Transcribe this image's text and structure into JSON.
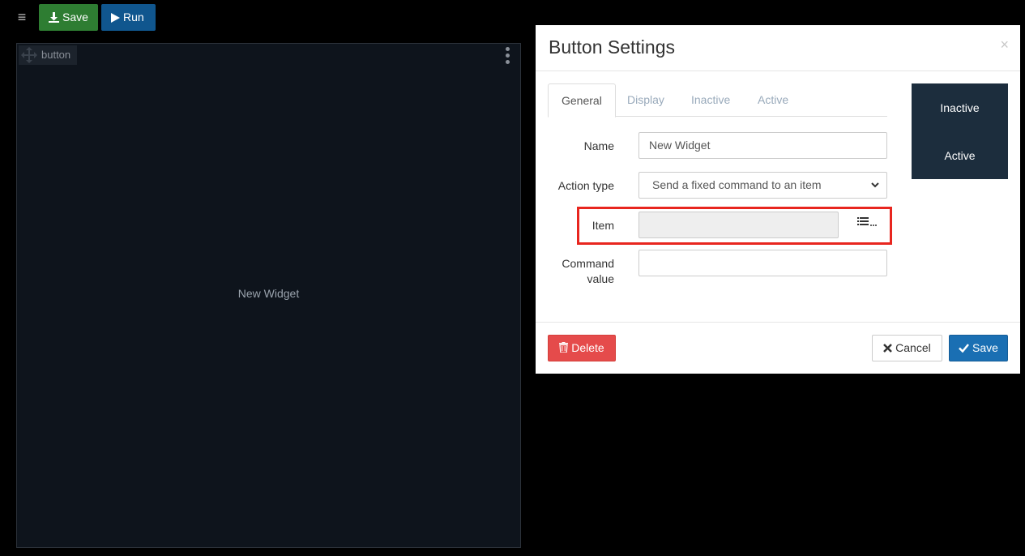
{
  "toolbar": {
    "save_label": "Save",
    "run_label": "Run"
  },
  "canvas": {
    "widget_tag": "button",
    "widget_label": "New Widget"
  },
  "modal": {
    "title": "Button Settings",
    "close": "×",
    "tabs": [
      {
        "label": "General"
      },
      {
        "label": "Display"
      },
      {
        "label": "Inactive"
      },
      {
        "label": "Active"
      }
    ],
    "form": {
      "name_label": "Name",
      "name_value": "New Widget",
      "action_label": "Action type",
      "action_value": "Send a fixed command to an item",
      "item_label": "Item",
      "item_value": "",
      "command_label_1": "Command",
      "command_label_2": "value",
      "command_value": ""
    },
    "preview": {
      "inactive": "Inactive",
      "active": "Active"
    },
    "footer": {
      "delete_label": "Delete",
      "cancel_label": "Cancel",
      "save_label": "Save"
    }
  },
  "colors": {
    "toolbar_save": "#2e7d32",
    "toolbar_run": "#10568e",
    "delete": "#e54b4b",
    "save": "#1a6fb3",
    "highlight": "#e8261f",
    "preview_bg": "#1c2d3d"
  }
}
